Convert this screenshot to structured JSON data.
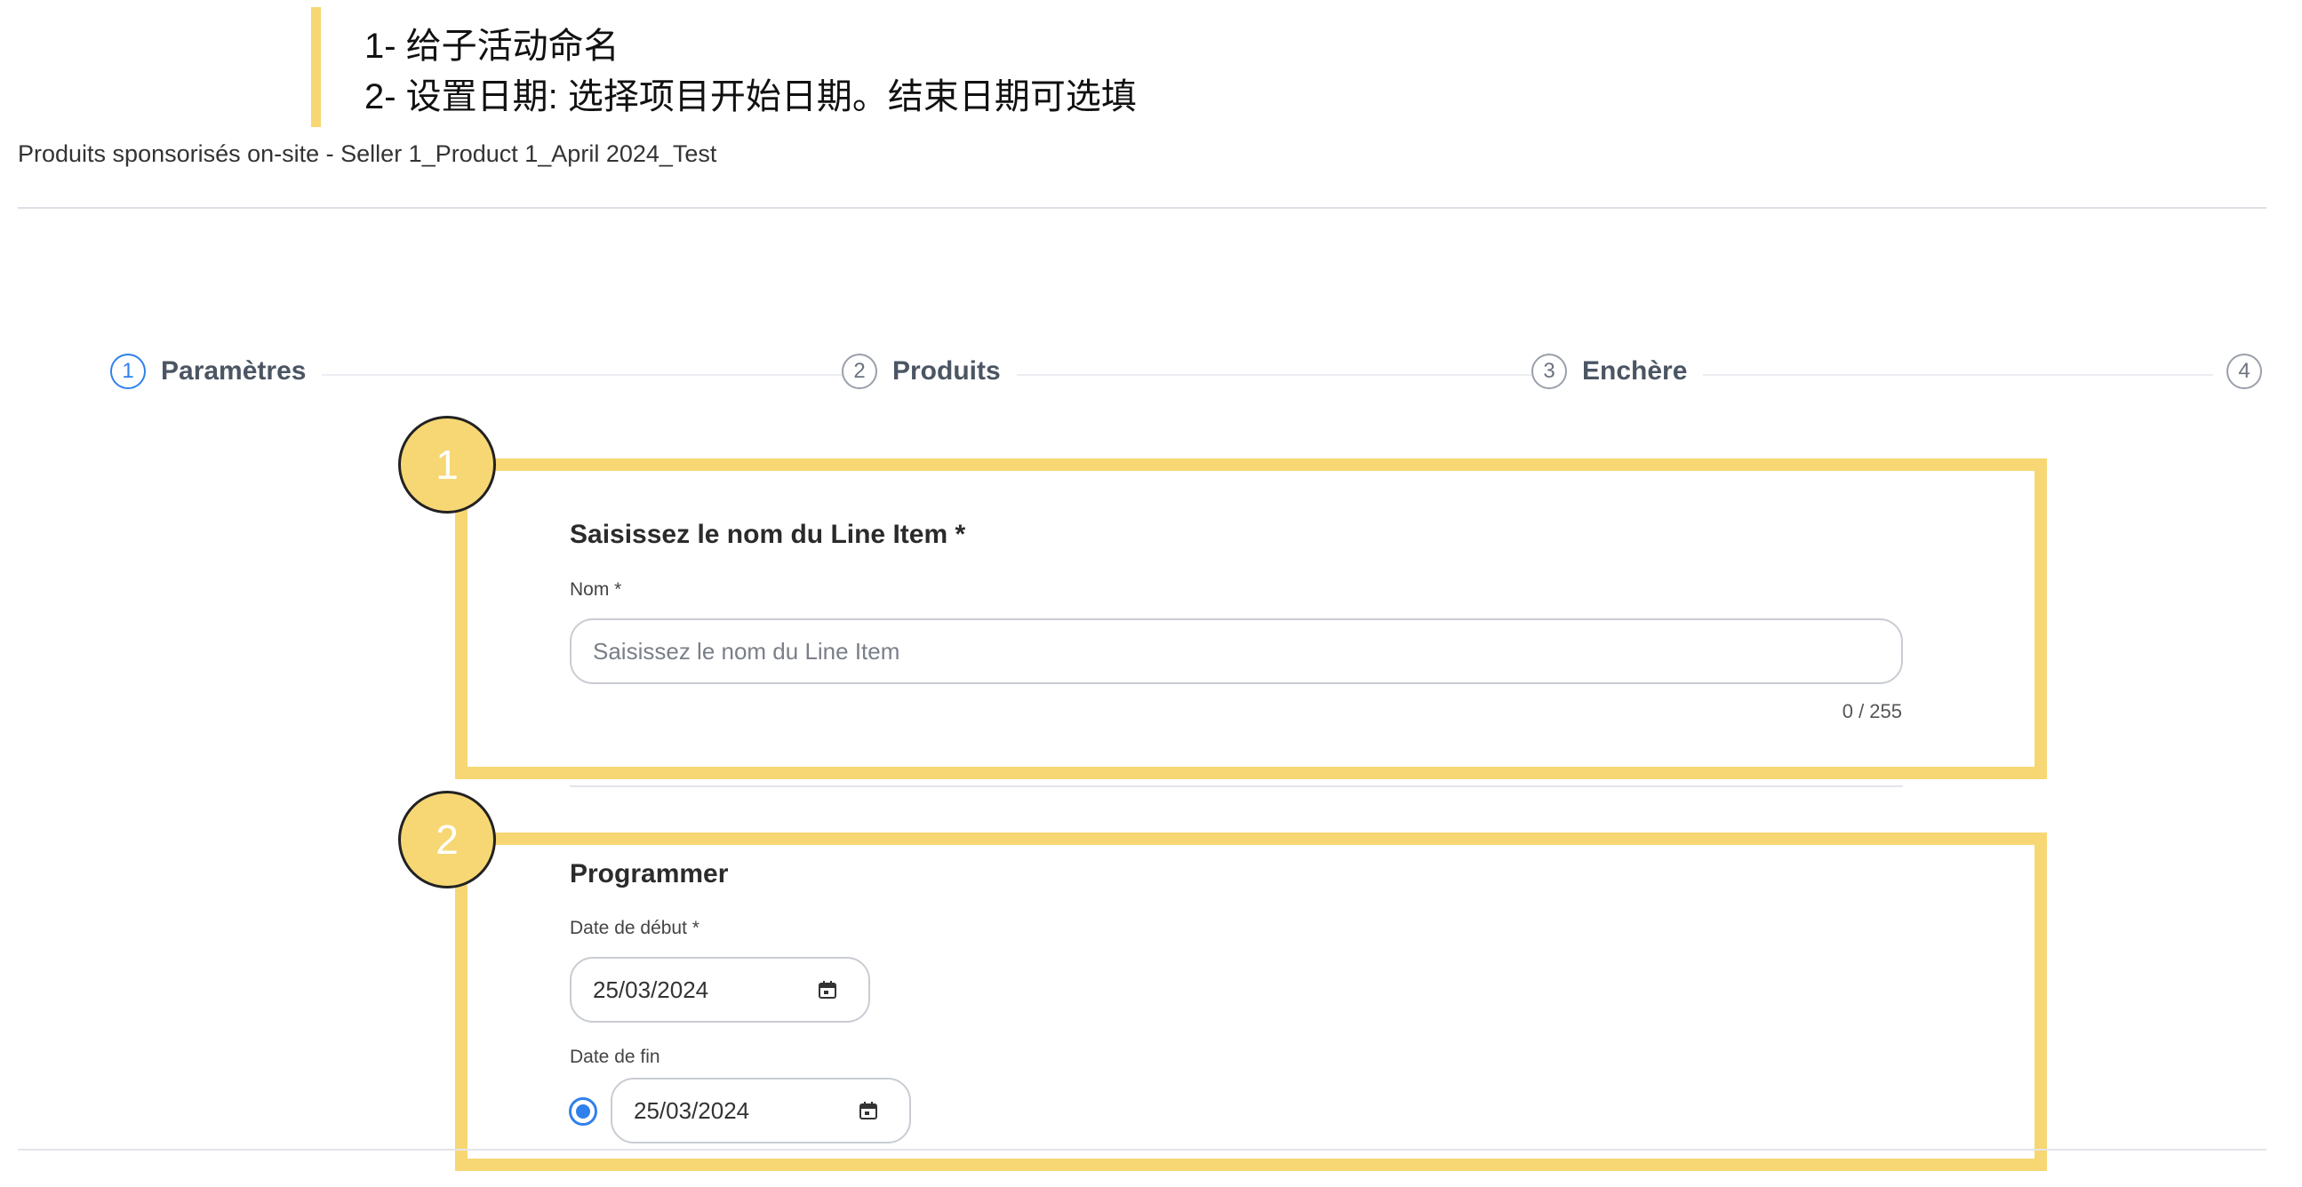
{
  "instructions": {
    "line1": "1- 给子活动命名",
    "line2": "2- 设置日期: 选择项目开始日期。结束日期可选填"
  },
  "page": {
    "subtitle": "Produits sponsorisés on-site - Seller 1_Product 1_April 2024_Test"
  },
  "stepper": {
    "steps": [
      {
        "number": "1",
        "label": "Paramètres",
        "active": true
      },
      {
        "number": "2",
        "label": "Produits",
        "active": false
      },
      {
        "number": "3",
        "label": "Enchère",
        "active": false
      },
      {
        "number": "4",
        "label": "",
        "active": false
      }
    ]
  },
  "annotations": {
    "badge1": "1",
    "badge2": "2",
    "highlight_color": "#f7d774"
  },
  "name_section": {
    "title": "Saisissez le nom du Line Item",
    "required_mark": "*",
    "field_label": "Nom *",
    "placeholder": "Saisissez le nom du Line Item",
    "value": "",
    "counter": "0 / 255"
  },
  "schedule_section": {
    "title": "Programmer",
    "start_label": "Date de début *",
    "start_value": "25/03/2024",
    "end_label": "Date de fin",
    "end_value": "25/03/2024",
    "end_enabled": true,
    "calendar_icon": "calendar-icon"
  },
  "colors": {
    "accent": "#2f80ed",
    "highlight": "#f7d774"
  }
}
